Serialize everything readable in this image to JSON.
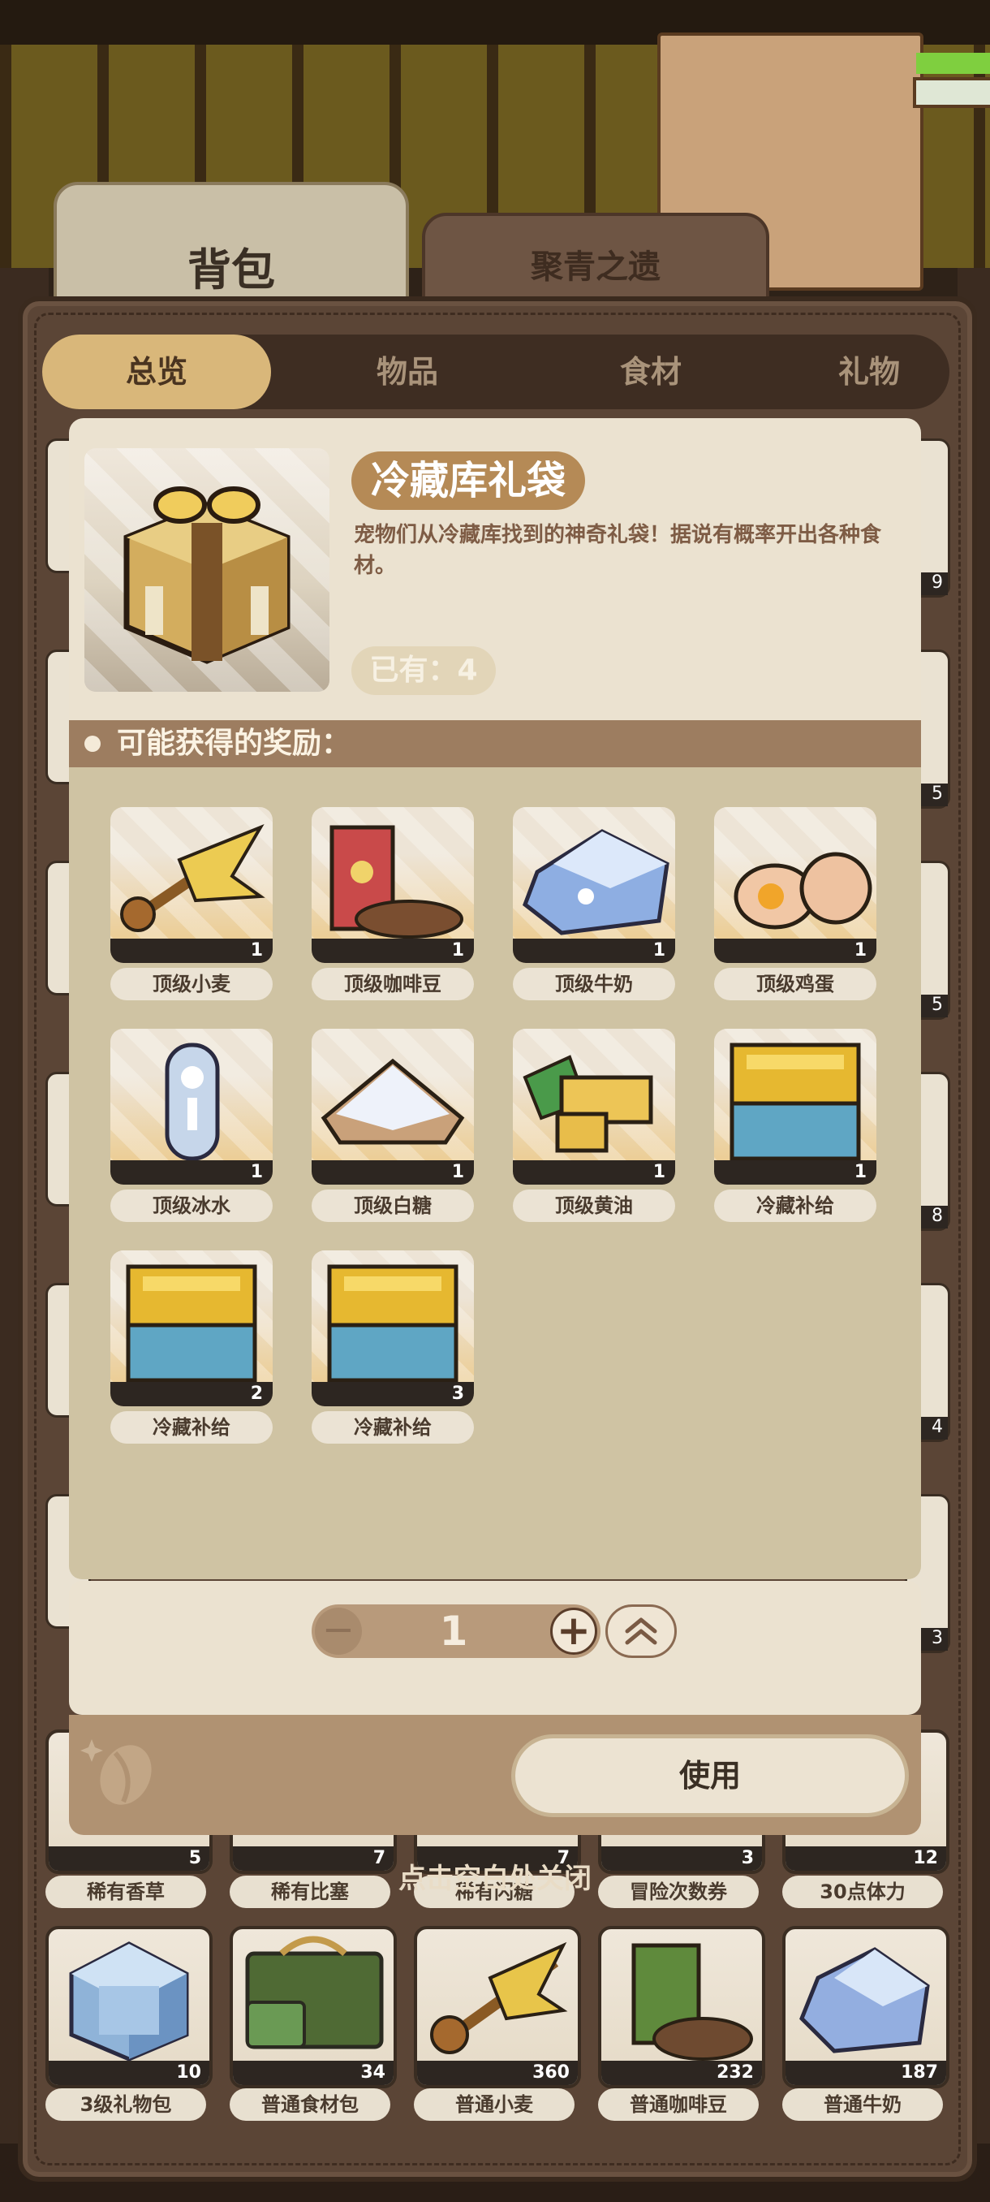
{
  "top_tabs": [
    "背包",
    "聚青之遗"
  ],
  "category_tabs": [
    "总览",
    "物品",
    "食材",
    "礼物"
  ],
  "item": {
    "name": "冷藏库礼袋",
    "description": "宠物们从冷藏库找到的神奇礼袋！据说有概率开出各种食材。",
    "owned_label": "已有：4"
  },
  "rewards": {
    "title": "可能获得的奖励：",
    "items": [
      {
        "name": "顶级小麦",
        "count": "1",
        "icon": "wheat-icon"
      },
      {
        "name": "顶级咖啡豆",
        "count": "1",
        "icon": "coffee-bean-icon"
      },
      {
        "name": "顶级牛奶",
        "count": "1",
        "icon": "milk-icon"
      },
      {
        "name": "顶级鸡蛋",
        "count": "1",
        "icon": "egg-icon"
      },
      {
        "name": "顶级冰水",
        "count": "1",
        "icon": "ice-water-icon"
      },
      {
        "name": "顶级白糖",
        "count": "1",
        "icon": "sugar-icon"
      },
      {
        "name": "顶级黄油",
        "count": "1",
        "icon": "butter-icon"
      },
      {
        "name": "冷藏补给",
        "count": "1",
        "icon": "cold-supply-icon"
      },
      {
        "name": "冷藏补给",
        "count": "2",
        "icon": "cold-supply-icon"
      },
      {
        "name": "冷藏补给",
        "count": "3",
        "icon": "cold-supply-icon"
      }
    ]
  },
  "quantity": {
    "minus": "−",
    "value": "1",
    "plus": "+",
    "max_icon": "double-chevron-up-icon"
  },
  "use_button": "使用",
  "close_hint": "点击空白处关闭",
  "backpack_row_partial": [
    {
      "name": "稀有香草",
      "count": "5"
    },
    {
      "name": "稀有比塞",
      "count": "7"
    },
    {
      "name": "稀有闪糖",
      "count": "7"
    },
    {
      "name": "冒险次数券",
      "count": "3"
    },
    {
      "name": "30点体力",
      "count": "12"
    }
  ],
  "backpack_row_bottom": [
    {
      "name": "3级礼物包",
      "count": "10",
      "icon": "gift-cube-icon"
    },
    {
      "name": "普通食材包",
      "count": "34",
      "icon": "ingredient-bag-icon"
    },
    {
      "name": "普通小麦",
      "count": "360",
      "icon": "wheat-icon"
    },
    {
      "name": "普通咖啡豆",
      "count": "232",
      "icon": "coffee-bean-icon"
    },
    {
      "name": "普通牛奶",
      "count": "187",
      "icon": "milk-icon"
    }
  ],
  "side_counts": [
    "9",
    "5",
    "5",
    "8",
    "4",
    "3"
  ],
  "colors": {
    "accent": "#b58a56",
    "panel": "#5b4536",
    "popup": "#ebe2d0",
    "rewards_bg": "#cfc3a3"
  }
}
